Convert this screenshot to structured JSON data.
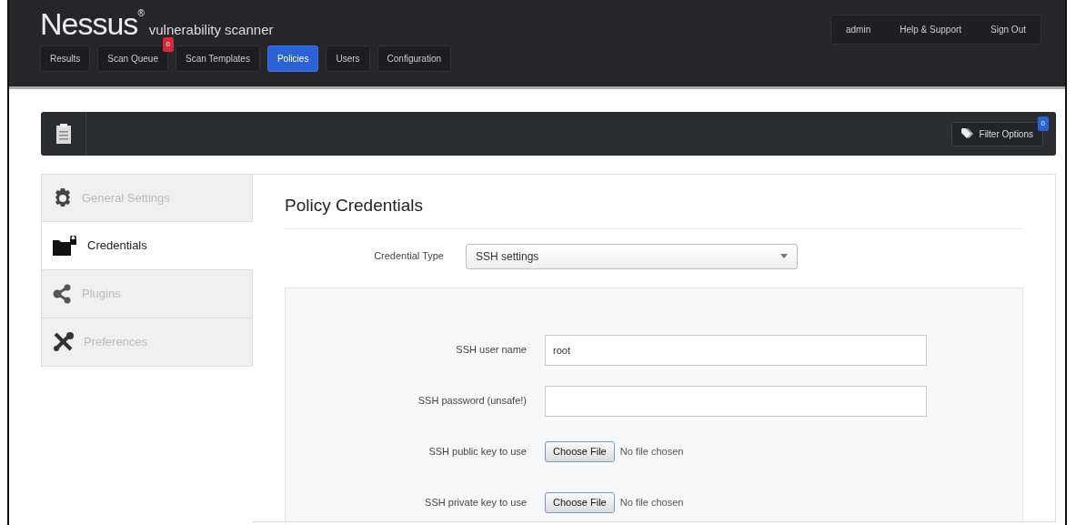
{
  "header": {
    "logo": "Nessus$^{®}$",
    "tagline": "vulnerability scanner",
    "nav": [
      {
        "label": "Results",
        "selected": false
      },
      {
        "label": "Scan Queue",
        "selected": false,
        "badge": "0"
      },
      {
        "label": "Scan Templates",
        "selected": false
      },
      {
        "label": "Policies",
        "selected": true
      },
      {
        "label": "Users",
        "selected": false
      },
      {
        "label": "Configuration",
        "selected": false
      }
    ],
    "user_menu": [
      "admin",
      "Help & Support",
      "Sign Out"
    ]
  },
  "toolbar": {
    "filter_button": {
      "label": "Filter Options",
      "badge": "0"
    }
  },
  "sidebar": {
    "items": [
      {
        "label": "General Settings",
        "selected": false
      },
      {
        "label": "Credentials",
        "selected": true
      },
      {
        "label": "Plugins",
        "selected": false
      },
      {
        "label": "Preferences",
        "selected": false
      }
    ]
  },
  "content": {
    "title": "Policy Credentials",
    "credential_type": {
      "label": "Credential Type",
      "value": "SSH settings"
    },
    "fields": [
      {
        "kind": "text",
        "label": "SSH user name",
        "value": "root"
      },
      {
        "kind": "text",
        "label": "SSH password (unsafe!)"
      },
      {
        "kind": "file",
        "label": "SSH public key to use",
        "button": "Choose File",
        "status": "No file chosen"
      },
      {
        "kind": "file",
        "label": "SSH private key to use",
        "button": "Choose File",
        "status": "No file chosen"
      }
    ]
  }
}
